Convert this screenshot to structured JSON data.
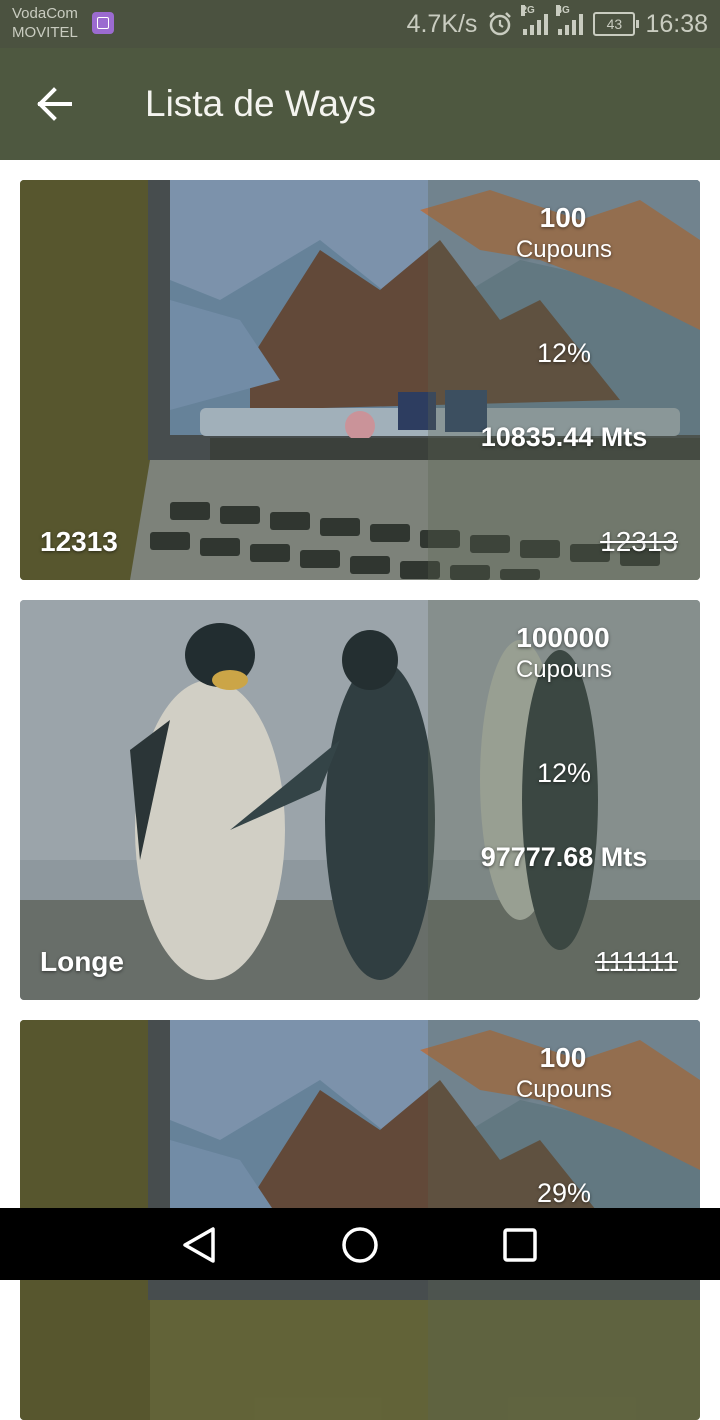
{
  "status_bar": {
    "carrier_line1": "VodaCom",
    "carrier_line2": "MOVITEL",
    "net_speed": "4.7K/s",
    "signal1_tag": "2G",
    "signal2_tag": "4G",
    "battery": "43",
    "time": "16:38",
    "icons": [
      "gallery-icon",
      "alarm-icon",
      "signal-icon",
      "battery-icon"
    ]
  },
  "app_bar": {
    "title": "Lista de Ways",
    "back_icon": "arrow-left-icon",
    "color": "#4e5840"
  },
  "cards": [
    {
      "image": "laptop-photo",
      "coupons": "100",
      "coupons_label": "Cupouns",
      "percent": "12%",
      "price": "10835.44 Mts",
      "left_label": "12313",
      "old_price": "12313"
    },
    {
      "image": "penguins-photo",
      "coupons": "100000",
      "coupons_label": "Cupouns",
      "percent": "12%",
      "price": "97777.68 Mts",
      "left_label": "Longe",
      "old_price": "111111"
    },
    {
      "image": "laptop-photo",
      "coupons": "100",
      "coupons_label": "Cupouns",
      "percent": "29%"
    }
  ],
  "nav_bar": {
    "icons": [
      "back-triangle-icon",
      "home-circle-icon",
      "recents-square-icon"
    ]
  }
}
